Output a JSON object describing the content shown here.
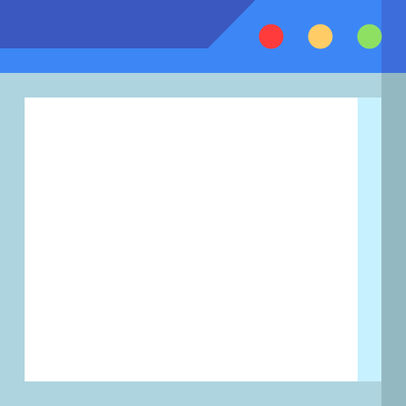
{
  "icon": {
    "name": "browser-window-icon",
    "colors": {
      "title_bar": "#3C87F5",
      "title_bar_tab": "#3A58BF",
      "title_bar_right_shade": "#3D6DDB",
      "frame": "#AED4DF",
      "frame_right_shade": "#94B8C2",
      "content_area": "#FFFFFF",
      "content_right_strip": "#C7F1FF",
      "control_close": "#FF3B3B",
      "control_minimize": "#FFCC66",
      "control_maximize": "#8EE063"
    },
    "controls": [
      {
        "name": "close-control-icon",
        "color_key": "control_close"
      },
      {
        "name": "minimize-control-icon",
        "color_key": "control_minimize"
      },
      {
        "name": "maximize-control-icon",
        "color_key": "control_maximize"
      }
    ]
  }
}
